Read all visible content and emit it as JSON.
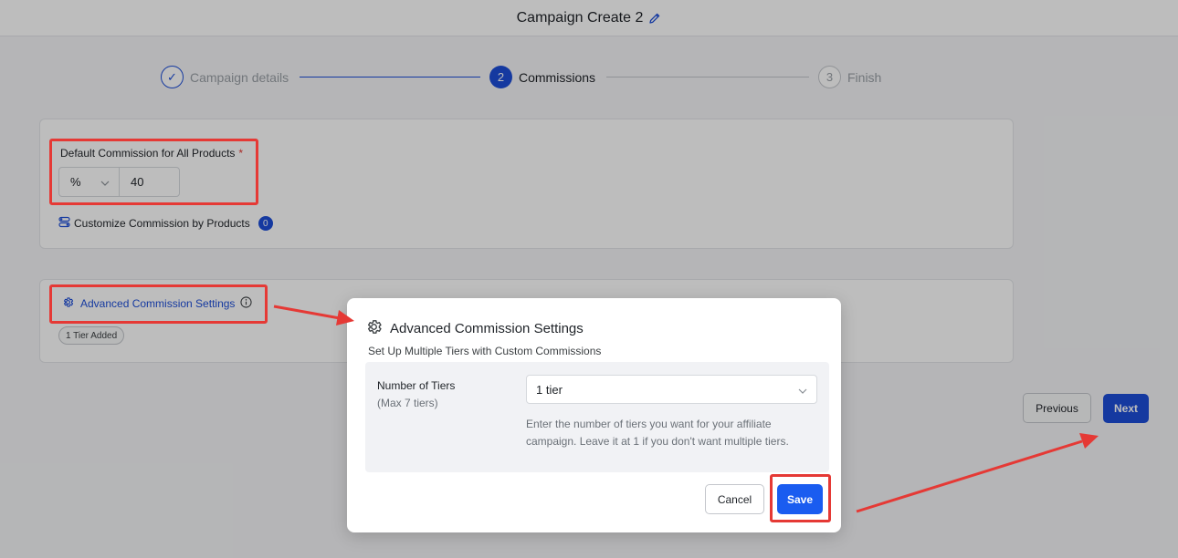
{
  "header": {
    "title": "Campaign Create 2",
    "edit_icon": "pencil-icon"
  },
  "stepper": {
    "steps": [
      {
        "number": "✓",
        "label": "Campaign details",
        "state": "done"
      },
      {
        "number": "2",
        "label": "Commissions",
        "state": "active"
      },
      {
        "number": "3",
        "label": "Finish",
        "state": "pending"
      }
    ]
  },
  "commission": {
    "label": "Default Commission for All Products",
    "required_mark": "*",
    "unit": "%",
    "value": "40",
    "customize_label": "Customize Commission by Products",
    "customize_count": "0"
  },
  "advanced": {
    "link_label": "Advanced Commission Settings",
    "tier_badge": "1 Tier Added"
  },
  "nav": {
    "previous_label": "Previous",
    "next_label": "Next"
  },
  "modal": {
    "title": "Advanced Commission Settings",
    "subtitle": "Set Up Multiple Tiers with Custom Commissions",
    "tiers_label": "Number of Tiers",
    "tiers_sub": "(Max 7 tiers)",
    "tiers_value": "1 tier",
    "help_text": "Enter the number of tiers you want for your affiliate campaign. Leave it at 1 if you don't want multiple tiers.",
    "cancel_label": "Cancel",
    "save_label": "Save"
  },
  "colors": {
    "accent": "#1d4ed8",
    "annotation": "#e53935",
    "save": "#1a5cf0"
  }
}
